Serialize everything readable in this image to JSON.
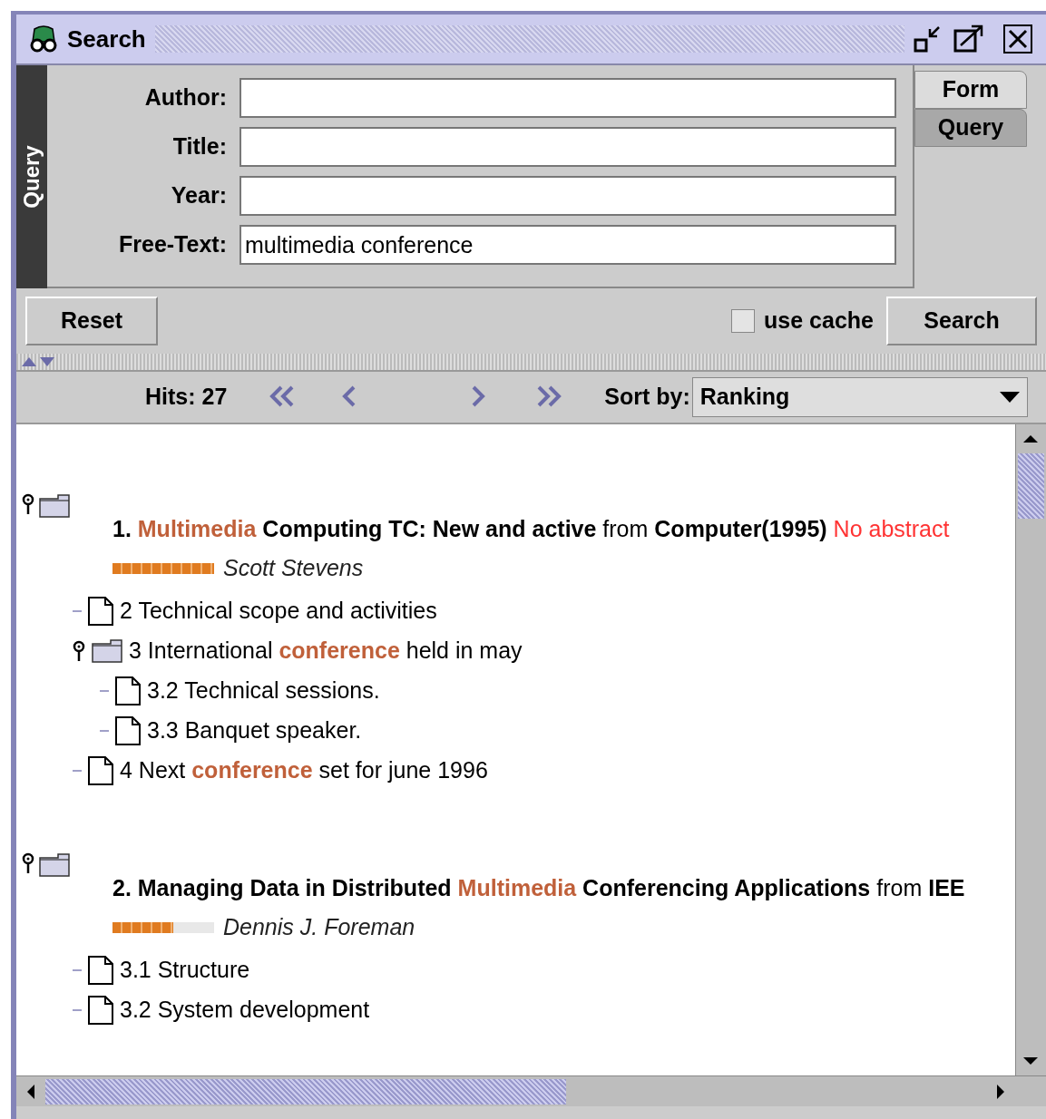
{
  "window": {
    "title": "Search"
  },
  "side_label": "Query",
  "fields": [
    {
      "label": "Author:"
    },
    {
      "label": "Title:"
    },
    {
      "label": "Year:"
    },
    {
      "label": "Free-Text:",
      "value": "multimedia conference"
    }
  ],
  "tabs": [
    {
      "label": "Form",
      "selected": true
    },
    {
      "label": "Query",
      "selected": false
    }
  ],
  "buttons": {
    "reset": "Reset",
    "search": "Search"
  },
  "use_cache": {
    "label": "use cache",
    "checked": false
  },
  "toolbar": {
    "hits": "Hits: 27",
    "sort_label": "Sort by:",
    "sort_value": "Ranking"
  },
  "results": [
    {
      "title": [
        {
          "text": "1. ",
          "kind": "bold"
        },
        {
          "text": "Multimedia",
          "kind": "hit"
        },
        {
          "text": " Computing TC: New and active",
          "kind": "bold"
        },
        {
          "text": " from ",
          "kind": "plain"
        },
        {
          "text": "Computer(1995)",
          "kind": "bold"
        },
        {
          "text": " No abstract",
          "kind": "note"
        }
      ],
      "level": 1.0,
      "author": "Scott Stevens",
      "children": [
        {
          "kind": "doc",
          "text": [
            {
              "text": "2 Technical scope and activities",
              "kind": "plain"
            }
          ]
        },
        {
          "kind": "folder",
          "text": [
            {
              "text": "3 International ",
              "kind": "plain"
            },
            {
              "text": "conference",
              "kind": "hit"
            },
            {
              "text": " held in may",
              "kind": "plain"
            }
          ],
          "children": [
            {
              "kind": "doc",
              "text": [
                {
                  "text": "3.2 Technical sessions.",
                  "kind": "plain"
                }
              ]
            },
            {
              "kind": "doc",
              "text": [
                {
                  "text": "3.3 Banquet speaker.",
                  "kind": "plain"
                }
              ]
            }
          ]
        },
        {
          "kind": "doc",
          "text": [
            {
              "text": "4 Next ",
              "kind": "plain"
            },
            {
              "text": "conference",
              "kind": "hit"
            },
            {
              "text": " set for june 1996",
              "kind": "plain"
            }
          ]
        }
      ]
    },
    {
      "title": [
        {
          "text": "2. Managing Data in Distributed ",
          "kind": "bold"
        },
        {
          "text": "Multimedia",
          "kind": "hit"
        },
        {
          "text": " Conferencing Applications",
          "kind": "bold"
        },
        {
          "text": " from ",
          "kind": "plain"
        },
        {
          "text": "IEE",
          "kind": "bold"
        }
      ],
      "level": 0.6,
      "author": "Dennis J. Foreman",
      "children": [
        {
          "kind": "doc",
          "text": [
            {
              "text": "3.1 Structure",
              "kind": "plain"
            }
          ]
        },
        {
          "kind": "doc",
          "text": [
            {
              "text": "3.2 System development",
              "kind": "plain"
            }
          ]
        }
      ]
    }
  ]
}
